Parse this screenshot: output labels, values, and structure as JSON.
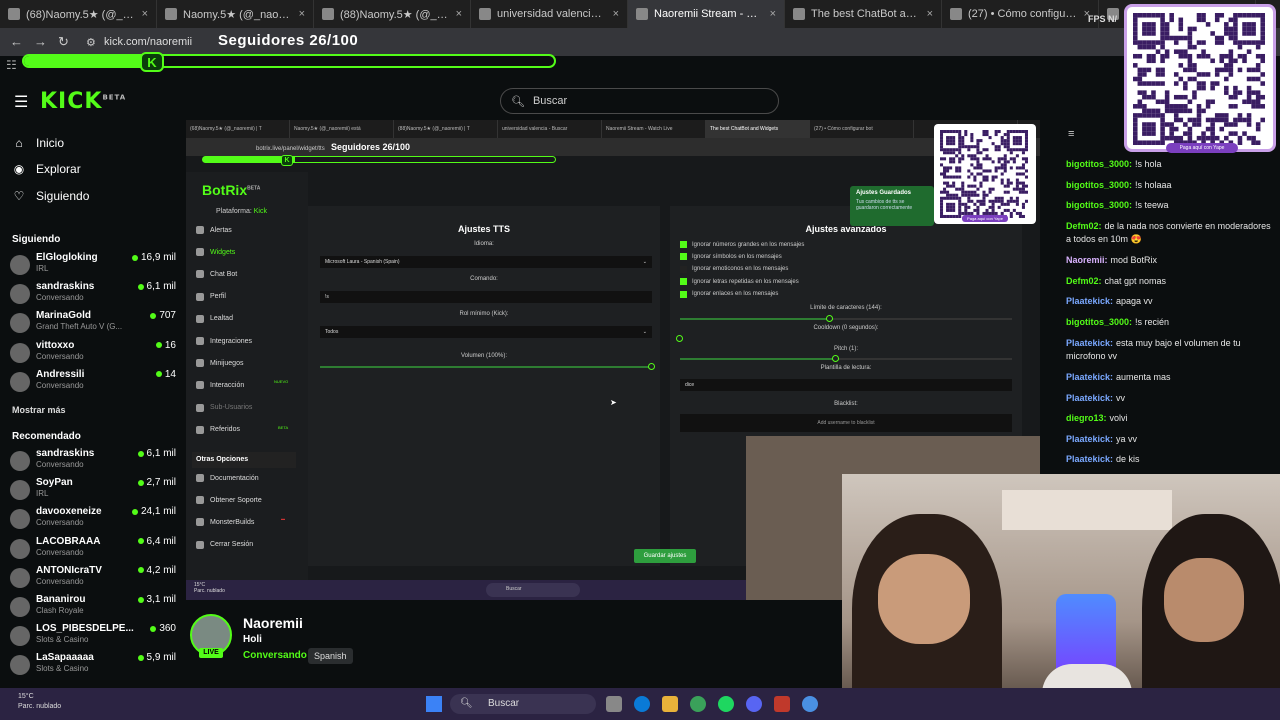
{
  "browser": {
    "tabs": [
      {
        "label": "(68)Naomy.5★ (@_naoremii) | T",
        "active": false
      },
      {
        "label": "Naomy.5★ (@_naoremii) está LI",
        "active": false
      },
      {
        "label": "(88)Naomy.5★ (@_naoremii) | T",
        "active": false
      },
      {
        "label": "universidad valencia - Buscar c",
        "active": false
      },
      {
        "label": "Naoremii Stream - Watch Live",
        "active": true
      },
      {
        "label": "The best ChatBot and Widgets",
        "active": false
      },
      {
        "label": "(27) • Cómo configurar bot",
        "active": false
      },
      {
        "label": "",
        "active": false
      }
    ],
    "url": "kick.com/naoremii",
    "fps_label": "FPS N/"
  },
  "overlay": {
    "followers_text": "Seguidores 26/100",
    "followers_current": 26,
    "followers_goal": 100,
    "qr_label": "Paga aquí con Yape"
  },
  "kick": {
    "logo": "KICK",
    "logo_sup": "BETA",
    "search_placeholder": "Buscar",
    "nav": [
      {
        "label": "Inicio",
        "icon": "home-icon"
      },
      {
        "label": "Explorar",
        "icon": "compass-icon"
      },
      {
        "label": "Siguiendo",
        "icon": "heart-icon"
      }
    ],
    "following_title": "Siguiendo",
    "following": [
      {
        "name": "ElGlogloking",
        "category": "IRL",
        "viewers": "16,9 mil"
      },
      {
        "name": "sandraskins",
        "category": "Conversando",
        "viewers": "6,1 mil"
      },
      {
        "name": "MarinaGold",
        "category": "Grand Theft Auto V (G...",
        "viewers": "707"
      },
      {
        "name": "vittoxxo",
        "category": "Conversando",
        "viewers": "16"
      },
      {
        "name": "Andressili",
        "category": "Conversando",
        "viewers": "14"
      }
    ],
    "show_more": "Mostrar más",
    "recommended_title": "Recomendado",
    "recommended": [
      {
        "name": "sandraskins",
        "category": "Conversando",
        "viewers": "6,1 mil"
      },
      {
        "name": "SoyPan",
        "category": "IRL",
        "viewers": "2,7 mil"
      },
      {
        "name": "davooxeneize",
        "category": "Conversando",
        "viewers": "24,1 mil"
      },
      {
        "name": "LACOBRAAA",
        "category": "Conversando",
        "viewers": "6,4 mil"
      },
      {
        "name": "ANTONIcraTV",
        "category": "Conversando",
        "viewers": "4,2 mil"
      },
      {
        "name": "Bananirou",
        "category": "Clash Royale",
        "viewers": "3,1 mil"
      },
      {
        "name": "LOS_PIBESDELPE...",
        "category": "Slots & Casino",
        "viewers": "360"
      },
      {
        "name": "LaSapaaaaa",
        "category": "Slots & Casino",
        "viewers": "5,9 mil"
      }
    ]
  },
  "stream_screen": {
    "tabs": [
      "(68)Naomy.5★ (@_naoremii) | T",
      "Naomy.5★ (@_naoremii) está",
      "(88)Naomy.5★ (@_naoremii) | T",
      "universidad valencia - Buscar",
      "Naoremii Stream - Watch Live",
      "The best ChatBot and Widgets",
      "(27) • Cómo configurar bot",
      ""
    ],
    "url": "botrix.live/panel/widget/tts",
    "followers_text": "Seguidores 26/100",
    "botrix": {
      "logo": "BotRix",
      "logo_sup": "BETA",
      "platform_label": "Plataforma:",
      "platform_value": "Kick",
      "menu": [
        {
          "label": "Alertas",
          "state": "normal"
        },
        {
          "label": "Widgets",
          "state": "active"
        },
        {
          "label": "Chat Bot",
          "state": "normal"
        },
        {
          "label": "Perfil",
          "state": "normal"
        },
        {
          "label": "Lealtad",
          "state": "normal"
        },
        {
          "label": "Integraciones",
          "state": "normal"
        },
        {
          "label": "Minijuegos",
          "state": "normal"
        },
        {
          "label": "Interacción",
          "state": "normal"
        },
        {
          "label": "Sub-Usuarios",
          "state": "dim"
        },
        {
          "label": "Referidos",
          "state": "normal"
        }
      ],
      "tag_new": "NUEVO",
      "tag_beta": "BETA",
      "other_title": "Otras Opciones",
      "other": [
        "Documentación",
        "Obtener Soporte",
        "MonsterBuilds",
        "Cerrar Sesión"
      ],
      "tts": {
        "title": "Ajustes TTS",
        "idioma_label": "Idioma:",
        "idioma_value": "Microsoft Laura - Spanish (Spain)",
        "comando_label": "Comando:",
        "comando_value": "!s",
        "rol_label": "Rol mínimo (Kick):",
        "rol_value": "Todos",
        "volumen_label": "Volumen (100%):",
        "volumen": 1.0
      },
      "advanced": {
        "title": "Ajustes avanzados",
        "checks": [
          {
            "label": "Ignorar números grandes en los mensajes",
            "on": true
          },
          {
            "label": "Ignorar símbolos en los mensajes",
            "on": true
          },
          {
            "label": "Ignorar emoticonos en los mensajes",
            "on": false
          },
          {
            "label": "Ignorar letras repetidas en los mensajes",
            "on": true
          },
          {
            "label": "Ignorar enlaces en los mensajes",
            "on": true
          }
        ],
        "limit_label": "Límite de caracteres (144):",
        "cooldown_label": "Cooldown (0 segundos):",
        "pitch_label": "Pitch (1):",
        "template_label": "Plantilla de lectura:",
        "template_value": "dice",
        "blacklist_label": "Blacklist:",
        "blacklist_placeholder": "Add username to blacklist"
      },
      "toast_title": "Ajustes Guardados",
      "toast_text": "Tus cambios de tts se guardaron correctamente",
      "save_button": "Guardar ajustes"
    },
    "weather": "15°C",
    "weather_sub": "Parc. nublado",
    "taskbar_search": "Buscar",
    "qr_label": "Paga aquí con Yape"
  },
  "chat": {
    "messages": [
      {
        "user": "bigotitos_3000:",
        "text": "!s hola",
        "color": "#53fc18"
      },
      {
        "user": "bigotitos_3000:",
        "text": "!s holaaa",
        "color": "#53fc18"
      },
      {
        "user": "bigotitos_3000:",
        "text": "!s teewa",
        "color": "#53fc18"
      },
      {
        "user": "Defm02:",
        "text": "de la nada nos convierte en moderadores a todos en 10m 😍",
        "color": "#53fc18"
      },
      {
        "user": "Naoremii:",
        "text": "mod BotRix",
        "color": "#d9b3ff"
      },
      {
        "user": "Defm02:",
        "text": "chat gpt nomas",
        "color": "#53fc18"
      },
      {
        "user": "Plaatekick:",
        "text": "apaga vv",
        "color": "#7aa8ff"
      },
      {
        "user": "bigotitos_3000:",
        "text": "!s recién",
        "color": "#53fc18"
      },
      {
        "user": "Plaatekick:",
        "text": "esta muy bajo el volumen de tu microfono vv",
        "color": "#7aa8ff"
      },
      {
        "user": "Plaatekick:",
        "text": "aumenta mas",
        "color": "#7aa8ff"
      },
      {
        "user": "Plaatekick:",
        "text": "vv",
        "color": "#7aa8ff"
      },
      {
        "user": "diegro13:",
        "text": "volvi",
        "color": "#53fc18"
      },
      {
        "user": "Plaatekick:",
        "text": "ya vv",
        "color": "#7aa8ff"
      },
      {
        "user": "Plaatekick:",
        "text": "de kis",
        "color": "#7aa8ff"
      }
    ]
  },
  "streamer": {
    "name": "Naoremii",
    "title": "Holi",
    "category": "Conversando",
    "language": "Spanish",
    "live": "LIVE"
  },
  "taskbar": {
    "weather": "15°C",
    "weather_sub": "Parc. nublado",
    "search": "Buscar"
  },
  "colors": {
    "kick_green": "#53fc18",
    "background": "#0b0e0f",
    "taskbar": "#2b2342"
  }
}
